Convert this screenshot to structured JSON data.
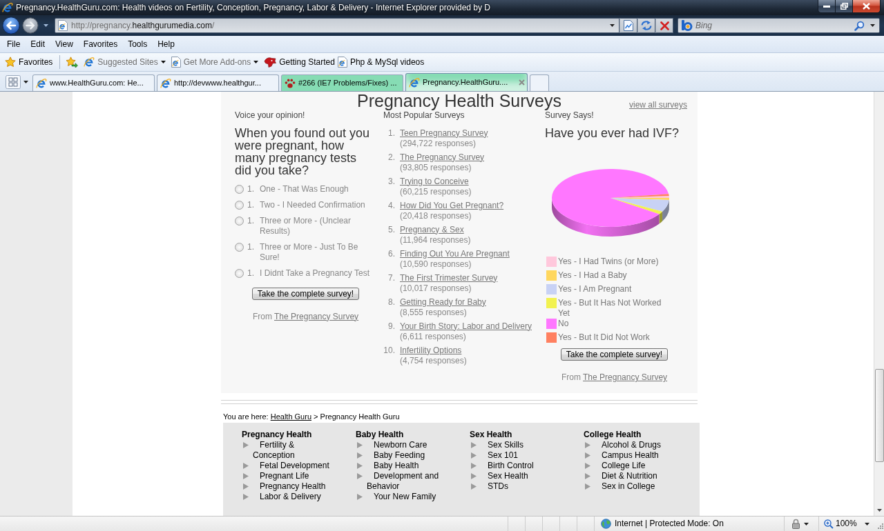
{
  "window": {
    "title": "Pregnancy.HealthGuru.com: Health videos on Fertility, Conception, Pregnancy, Labor & Delivery - Internet Explorer provided by D"
  },
  "address_bar": {
    "url_prefix": "http://pregnancy.",
    "url_domain": "healthgurumedia.com",
    "url_suffix": "/"
  },
  "search_box": {
    "placeholder": "Bing"
  },
  "menu_bar": [
    "File",
    "Edit",
    "View",
    "Favorites",
    "Tools",
    "Help"
  ],
  "favorites_bar": {
    "label": "Favorites",
    "items": [
      {
        "label": "Suggested Sites",
        "kind": "menu",
        "disabled": true
      },
      {
        "label": "Get More Add-ons",
        "kind": "menu",
        "disabled": true
      },
      {
        "label": "Getting Started",
        "kind": "link",
        "disabled": false
      },
      {
        "label": "Php & MySql videos",
        "kind": "link",
        "disabled": false
      }
    ]
  },
  "tabs": [
    {
      "label": "www.HealthGuru.com: He...",
      "selected": false,
      "color": "#edf3fa"
    },
    {
      "label": "http://devwww.healthgur...",
      "selected": false,
      "color": "#edf3fa"
    },
    {
      "label": "#266 (IE7 Problems/Fixes) ...",
      "selected": false,
      "color": "#86dcb4"
    },
    {
      "label": "Pregnancy.HealthGuru....",
      "selected": true,
      "color": "#86dcb4"
    }
  ],
  "page": {
    "title": "Pregnancy Health Surveys",
    "view_all": "view all surveys",
    "poll": {
      "heading": "Voice your opinion!",
      "question": "When you found out you were pregnant, how many pregnancy tests did you take?",
      "options": [
        {
          "number": "1.",
          "label": "One - That Was Enough",
          "selected": false
        },
        {
          "number": "1.",
          "label": "Two - I Needed Confirmation",
          "selected": false
        },
        {
          "number": "1.",
          "label": "Three or More - (Unclear Results)",
          "selected": false
        },
        {
          "number": "1.",
          "label": "Three or More - Just To Be Sure!",
          "selected": false
        },
        {
          "number": "1.",
          "label": "I Didnt Take a Pregnancy Test",
          "selected": false
        }
      ],
      "button": "Take the complete survey!",
      "source": {
        "prefix": "From",
        "link": "The Pregnancy Survey"
      }
    },
    "popular": {
      "heading": "Most Popular Surveys",
      "items": [
        {
          "number": "1.",
          "title": "Teen Pregnancy Survey",
          "responses": "(294,722 responses)"
        },
        {
          "number": "2.",
          "title": "The Pregnancy Survey",
          "responses": "(93,805 responses)"
        },
        {
          "number": "3.",
          "title": "Trying to Conceive",
          "responses": "(60,215 responses)"
        },
        {
          "number": "4.",
          "title": "How Did You Get Pregnant?",
          "responses": "(20,418 responses)"
        },
        {
          "number": "5.",
          "title": "Pregnancy & Sex",
          "responses": "(11,964 responses)"
        },
        {
          "number": "6.",
          "title": "Finding Out You Are Pregnant",
          "responses": "(10,590 responses)"
        },
        {
          "number": "7.",
          "title": "The First Trimester Survey",
          "responses": "(10,017 responses)"
        },
        {
          "number": "8.",
          "title": "Getting Ready for Baby",
          "responses": "(8,555 responses)"
        },
        {
          "number": "9.",
          "title": "Your Birth Story: Labor and Delivery",
          "responses": "(6,611 responses)"
        },
        {
          "number": "10.",
          "title": "Infertility Options",
          "responses": "(4,754 responses)"
        }
      ]
    },
    "results": {
      "heading": "Survey Says!",
      "question": "Have you ever had IVF?",
      "legend": [
        {
          "label": "Yes - I Had Twins (or More)",
          "color": "#ffc8dc"
        },
        {
          "label": "Yes - I Had a Baby",
          "color": "#ffd75e"
        },
        {
          "label": "Yes - I Am Pregnant",
          "color": "#c8d2f5"
        },
        {
          "label": "Yes - But It Has Not Worked Yet",
          "color": "#f2f250"
        },
        {
          "label": "No",
          "color": "#ff77ff"
        },
        {
          "label": "Yes - But It Did Not Work",
          "color": "#ff8060"
        }
      ],
      "button": "Take the complete survey!",
      "source": {
        "prefix": "From",
        "link": "The Pregnancy Survey"
      }
    }
  },
  "breadcrumb": {
    "prefix": "You are here:",
    "link": "Health Guru",
    "separator": ">",
    "current": "Pregnancy Health Guru"
  },
  "footer_nav": [
    {
      "heading": "Pregnancy Health",
      "links": [
        "Fertility & Conception",
        "Fetal Development",
        "Pregnant Life",
        "Pregnancy Health",
        "Labor & Delivery"
      ]
    },
    {
      "heading": "Baby Health",
      "links": [
        "Newborn Care",
        "Baby Feeding",
        "Baby Health",
        "Development and Behavior",
        "Your New Family"
      ]
    },
    {
      "heading": "Sex Health",
      "links": [
        "Sex Skills",
        "Sex 101",
        "Birth Control",
        "Sex Health",
        "STDs"
      ]
    },
    {
      "heading": "College Health",
      "links": [
        "Alcohol & Drugs",
        "Campus Health",
        "College Life",
        "Diet & Nutrition",
        "Sex in College"
      ]
    }
  ],
  "status_bar": {
    "zone": "Internet | Protected Mode: On",
    "zoom": "100%"
  }
}
